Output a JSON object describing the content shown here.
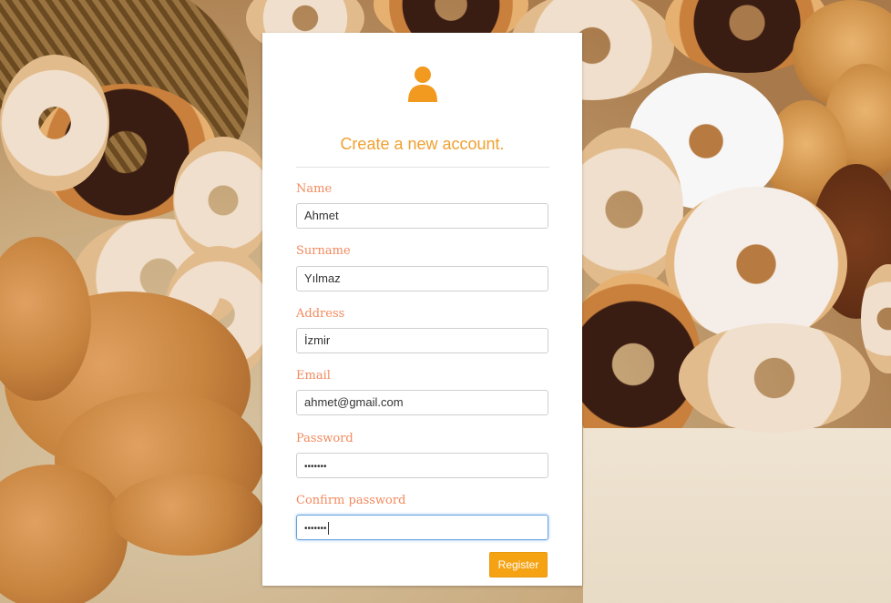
{
  "form": {
    "title": "Create a new account.",
    "icon": "user-icon",
    "accent_color": "#f0a030",
    "label_color": "#f28a5e",
    "button_color": "#f5a312",
    "fields": {
      "name": {
        "label": "Name",
        "value": "Ahmet"
      },
      "surname": {
        "label": "Surname",
        "value": "Yılmaz"
      },
      "address": {
        "label": "Address",
        "value": "İzmir"
      },
      "email": {
        "label": "Email",
        "value": "ahmet@gmail.com"
      },
      "password": {
        "label": "Password",
        "value": "•••••••"
      },
      "confirm_password": {
        "label": "Confirm password",
        "value": "•••••••"
      }
    },
    "register_label": "Register"
  },
  "background": {
    "description_icon": "bakery-photo"
  }
}
